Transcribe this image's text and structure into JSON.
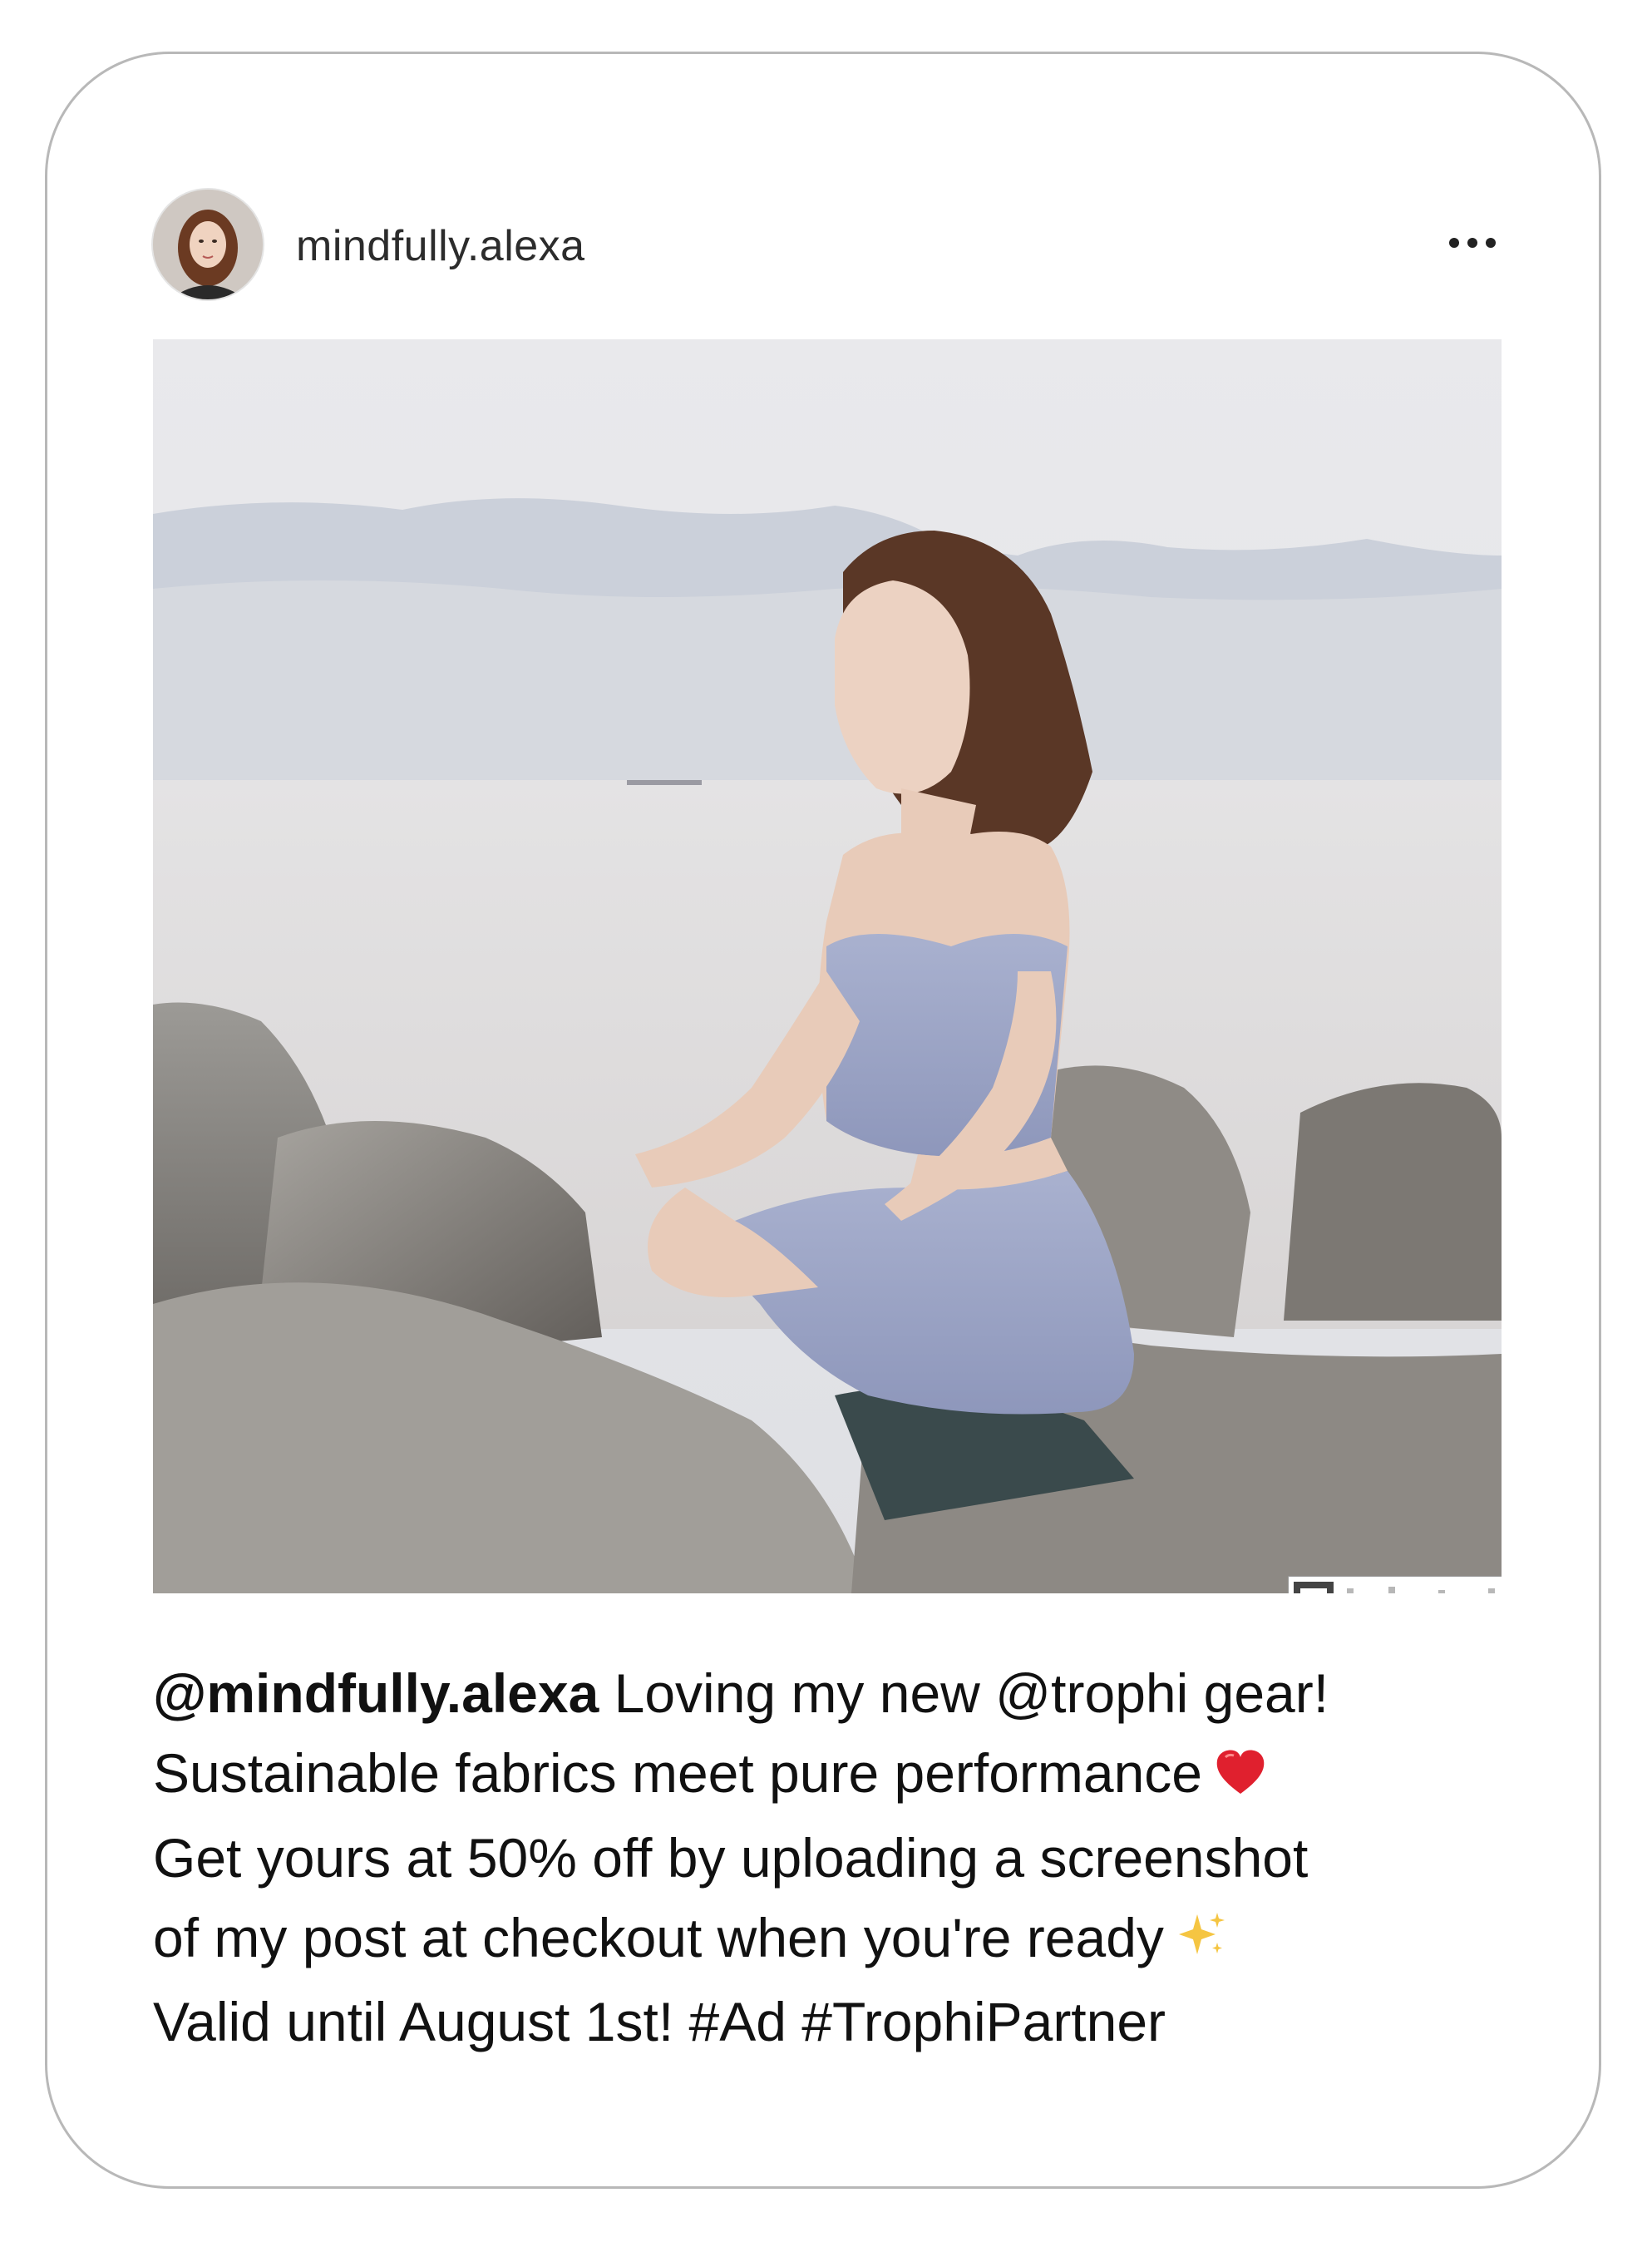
{
  "post": {
    "username": "mindfully.alexa",
    "more_icon": "ellipsis-icon",
    "image_alt": "Woman meditating on rocks by the sea",
    "qr_icon": "trophy-icon"
  },
  "caption": {
    "handle": "@mindfully.alexa",
    "line1": " Loving my new @trophi gear!",
    "line2": "Sustainable fabrics meet pure performance",
    "line2_emoji": "heart-emoji",
    "line3": "Get yours at 50% off by uploading a screenshot",
    "line4": "of my post at checkout when you're ready",
    "line4_emoji": "sparkles-emoji",
    "line5": "Valid until August 1st! #Ad #TrophiPartner"
  },
  "colors": {
    "text": "#111111",
    "card_border": "#b8b8b8",
    "heart": "#e0202e",
    "sparkle": "#f5c542"
  }
}
